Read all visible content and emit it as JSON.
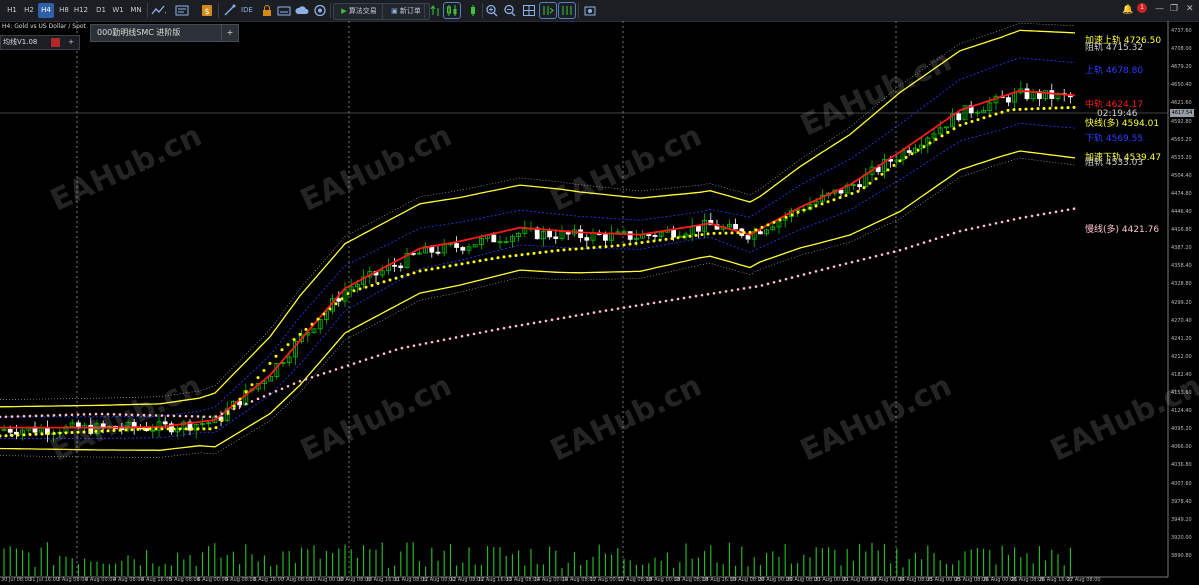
{
  "toolbar": {
    "timeframes": [
      {
        "label": "H1",
        "active": false
      },
      {
        "label": "H2",
        "active": false
      },
      {
        "label": "H4",
        "active": true
      },
      {
        "label": "H8",
        "active": false
      },
      {
        "label": "H12",
        "active": false
      },
      {
        "label": "D1",
        "active": false
      },
      {
        "label": "W1",
        "active": false
      },
      {
        "label": "MN",
        "active": false
      }
    ],
    "ide_label": "IDE",
    "algo_trading_label": "算法交易",
    "new_order_label": "新订单",
    "notification_count": "1"
  },
  "chart": {
    "symbol_info": "H4: Gold vs US Dollar / Spot",
    "indicator_panel_label": "均线V1.08",
    "ea_panel_label": "000勤明线SMC 进阶版",
    "current_price_tag": "4617.54",
    "levels": [
      {
        "label": "加速上轨 4726.50",
        "color": "#ffff33"
      },
      {
        "label": "阻轨 4715.32",
        "color": "#cfcfcf"
      },
      {
        "label": "上轨 4678.80",
        "color": "#2e3cff"
      },
      {
        "label": "中轨 4624.17",
        "color": "#ff1a1a"
      },
      {
        "label": "02:19:46",
        "color": "#cfcfcf"
      },
      {
        "label": "快线(多) 4594.01",
        "color": "#ffff33"
      },
      {
        "label": "下轨 4569.55",
        "color": "#2e3cff"
      },
      {
        "label": "加速下轨 4539.47",
        "color": "#ffff33"
      },
      {
        "label": "阻轨 4533.03",
        "color": "#cfcfcf"
      },
      {
        "label": "慢线(多) 4421.76",
        "color": "#ffc0cb"
      }
    ],
    "price_axis": [
      "4737.60",
      "4708.00",
      "4679.20",
      "4650.40",
      "4621.60",
      "4592.80",
      "4563.20",
      "4533.20",
      "4504.40",
      "4474.80",
      "4446.40",
      "4416.80",
      "4387.20",
      "4358.40",
      "4328.80",
      "4299.20",
      "4270.40",
      "4241.20",
      "4212.00",
      "4182.40",
      "4153.60",
      "4124.40",
      "4095.20",
      "4066.00",
      "4036.80",
      "4007.60",
      "3978.40",
      "3949.20",
      "3920.00",
      "3890.80"
    ],
    "time_axis": [
      "30 Jul 08:00",
      "31 Jul 16:00",
      "3 Aug 08:00",
      "4 Aug 00:00",
      "4 Aug 08:00",
      "4 Aug 16:00",
      "5 Aug 08:00",
      "6 Aug 00:00",
      "6 Aug 08:00",
      "6 Aug 16:00",
      "7 Aug 08:00",
      "10 Aug 00:00",
      "10 Aug 08:00",
      "10 Aug 16:00",
      "11 Aug 08:00",
      "12 Aug 00:00",
      "12 Aug 08:00",
      "12 Aug 16:00",
      "13 Aug 08:00",
      "14 Aug 00:00",
      "14 Aug 08:00",
      "17 Aug 00:00",
      "17 Aug 08:00",
      "18 Aug 00:00",
      "18 Aug 08:00",
      "18 Aug 16:00",
      "19 Aug 08:00",
      "20 Aug 00:00",
      "20 Aug 08:00",
      "21 Aug 00:00",
      "21 Aug 08:00",
      "24 Aug 00:00",
      "24 Aug 08:00",
      "25 Aug 00:00",
      "25 Aug 08:00",
      "26 Aug 00:00",
      "26 Aug 08:00",
      "26 Aug 16:00",
      "27 Aug 08:00"
    ],
    "watermark": "EAHub.cn",
    "colors": {
      "background": "#000000",
      "bull": "#00c000",
      "bear": "#ffffff",
      "fast_dots": "#ffff00",
      "slow_dots": "#ffc0cb",
      "mid": "#ff1a1a",
      "inner": "#2e3cff",
      "outer": "#ffff33",
      "envelope": "#bdbdbd",
      "volume": "#27c427"
    }
  }
}
